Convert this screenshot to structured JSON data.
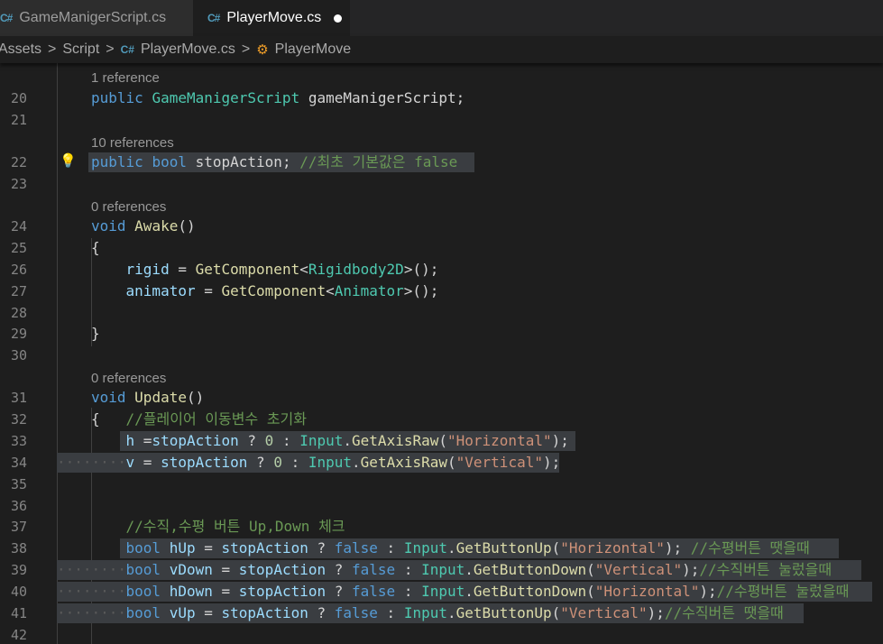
{
  "tabs": [
    {
      "icon": "C#",
      "label": "GameManigerScript.cs",
      "active": false
    },
    {
      "icon": "C#",
      "label": "PlayerMove.cs",
      "active": true,
      "dirty": true
    }
  ],
  "breadcrumb": [
    "Assets",
    "Script",
    "PlayerMove.cs",
    "PlayerMove"
  ],
  "codelens": [
    "1 reference",
    "10 references",
    "0 references",
    "0 references"
  ],
  "line_numbers": [
    "20",
    "21",
    "22",
    "23",
    "24",
    "25",
    "26",
    "27",
    "28",
    "29",
    "30",
    "31",
    "32",
    "33",
    "34",
    "35",
    "36",
    "37",
    "38",
    "39",
    "40",
    "41",
    "42"
  ],
  "code": {
    "l20": [
      "public",
      "GameManigerScript",
      "gameManigerScript",
      ";"
    ],
    "l22": [
      "public",
      "bool",
      "stopAction",
      ";",
      "//최초 기본값은 false"
    ],
    "l24": [
      "void",
      "Awake",
      "()"
    ],
    "l25": "{",
    "l26": [
      "rigid",
      " = ",
      "GetComponent",
      "<",
      "Rigidbody2D",
      ">();"
    ],
    "l27": [
      "animator",
      " = ",
      "GetComponent",
      "<",
      "Animator",
      ">();"
    ],
    "l29": "}",
    "l31": [
      "void",
      "Update",
      "()"
    ],
    "l32": [
      "{",
      "//플레이어 이동변수 초기화"
    ],
    "l33": [
      "h",
      " =",
      "stopAction",
      " ? ",
      "0",
      " : ",
      "Input",
      ".",
      "GetAxisRaw",
      "(",
      "\"Horizontal\"",
      ");"
    ],
    "l34": [
      "v",
      " = ",
      "stopAction",
      " ? ",
      "0",
      " : ",
      "Input",
      ".",
      "GetAxisRaw",
      "(",
      "\"Vertical\"",
      ");"
    ],
    "l37": "//수직,수평 버튼 Up,Down 체크",
    "l38": [
      "bool",
      "hUp",
      " = ",
      "stopAction",
      " ? ",
      "false",
      " : ",
      "Input",
      ".",
      "GetButtonUp",
      "(",
      "\"Horizontal\"",
      "); ",
      "//수평버튼 땟을때"
    ],
    "l39": [
      "bool",
      "vDown",
      " = ",
      "stopAction",
      " ? ",
      "false",
      " : ",
      "Input",
      ".",
      "GetButtonDown",
      "(",
      "\"Vertical\"",
      ");",
      "//수직버튼 눌렀을때"
    ],
    "l40": [
      "bool",
      "hDown",
      " = ",
      "stopAction",
      " ? ",
      "false",
      " : ",
      "Input",
      ".",
      "GetButtonDown",
      "(",
      "\"Horizontal\"",
      ");",
      "//수평버튼 눌렀을때"
    ],
    "l41": [
      "bool",
      "vUp",
      " = ",
      "stopAction",
      " ? ",
      "false",
      " : ",
      "Input",
      ".",
      "GetButtonUp",
      "(",
      "\"Vertical\"",
      ");",
      "//수직버튼 땟을때"
    ]
  },
  "colors": {
    "keyword": "#569cd6",
    "type": "#4ec9b0",
    "function": "#dcdcaa",
    "identifier": "#9cdcfe",
    "string": "#ce9178",
    "number": "#b5cea8",
    "comment": "#6a9955",
    "selection": "#3a3d41",
    "tab_active": "#1e1e1e",
    "tab_inactive": "#2d2d2d",
    "csharp_icon": "#519aba"
  },
  "icons": [
    "csharp-file-icon",
    "class-icon",
    "lightbulb-icon",
    "dirty-dot-icon"
  ]
}
